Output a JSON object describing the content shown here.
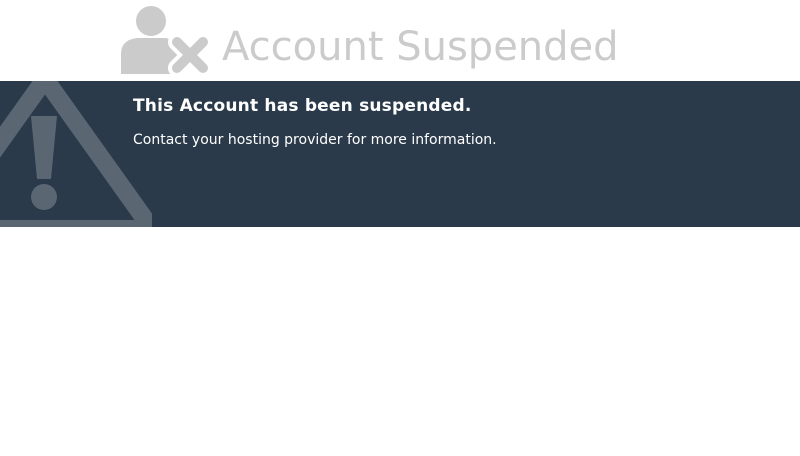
{
  "header": {
    "title": "Account Suspended",
    "icon": "user-suspended-icon"
  },
  "banner": {
    "heading": "This Account has been suspended.",
    "message": "Contact your hosting provider for more information.",
    "icon": "warning-icon"
  },
  "colors": {
    "banner_background": "#2a3a4a",
    "title_gray": "#cbcbcb",
    "warning_icon": "#5a6672"
  }
}
